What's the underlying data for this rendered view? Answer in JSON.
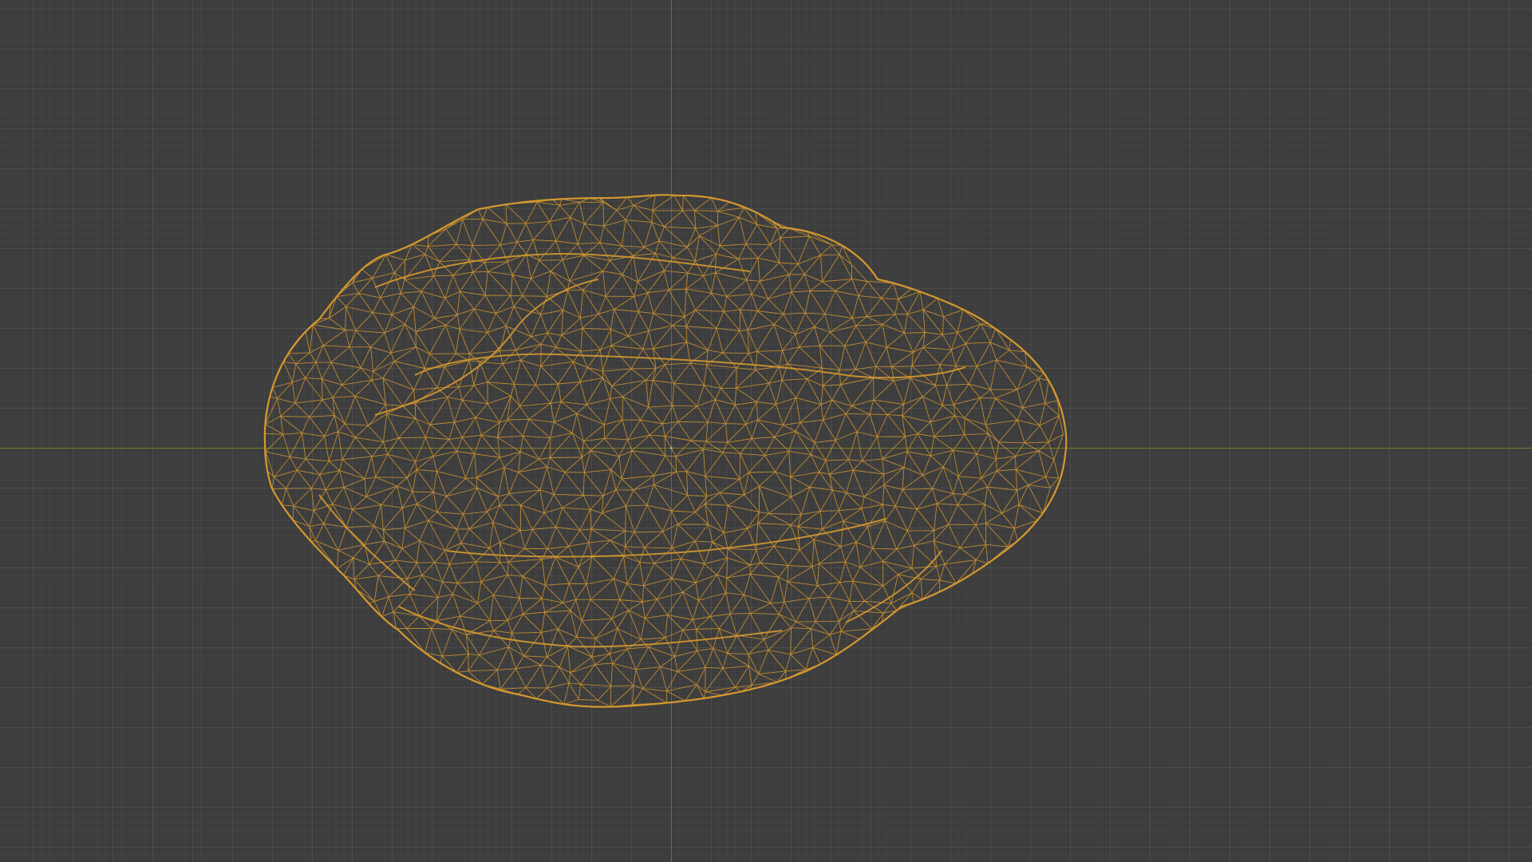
{
  "viewport": {
    "view": "wireframe",
    "grid": true
  },
  "colors": {
    "background": "#3d3d3d",
    "wire": "#d4982f",
    "axis_x": "#7a7f2a",
    "axis_y": "#3f6c96"
  },
  "mesh": {
    "shape": "irregular-rock",
    "display": "wireframe",
    "selected": true
  }
}
